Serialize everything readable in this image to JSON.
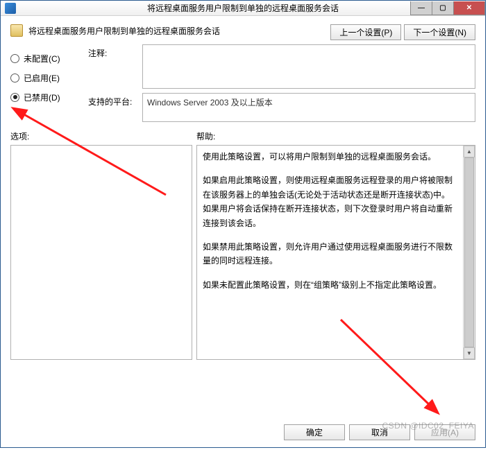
{
  "window": {
    "title": "将远程桌面服务用户限制到单独的远程桌面服务会话"
  },
  "header": {
    "policy_title": "将远程桌面服务用户限制到单独的远程桌面服务会话",
    "prev_btn": "上一个设置(P)",
    "next_btn": "下一个设置(N)"
  },
  "radios": {
    "not_configured": "未配置(C)",
    "enabled": "已启用(E)",
    "disabled": "已禁用(D)",
    "selected": "disabled"
  },
  "fields": {
    "comment_label": "注释:",
    "platform_label": "支持的平台:",
    "platform_value": "Windows Server 2003 及以上版本"
  },
  "labels": {
    "options": "选项:",
    "help": "帮助:"
  },
  "help": {
    "p1": "使用此策略设置，可以将用户限制到单独的远程桌面服务会话。",
    "p2": "如果启用此策略设置，则使用远程桌面服务远程登录的用户将被限制在该服务器上的单独会话(无论处于活动状态还是断开连接状态)中。如果用户将会话保持在断开连接状态，则下次登录时用户将自动重新连接到该会话。",
    "p3": "如果禁用此策略设置，则允许用户通过使用远程桌面服务进行不限数量的同时远程连接。",
    "p4": "如果未配置此策略设置，则在“组策略”级别上不指定此策略设置。"
  },
  "buttons": {
    "ok": "确定",
    "cancel": "取消",
    "apply": "应用(A)"
  },
  "watermark": "CSDN @IDC02_FEIYA"
}
